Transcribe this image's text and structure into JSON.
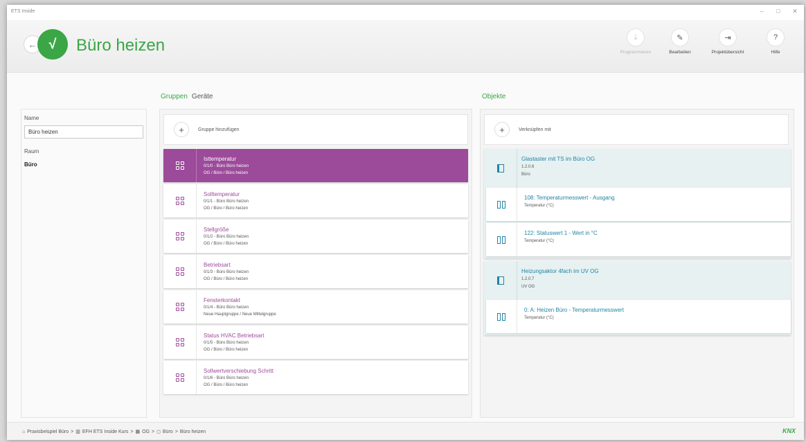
{
  "window": {
    "app_title": "ETS Inside",
    "controls": {
      "minimize": "–",
      "restore": "□",
      "close": "✕"
    }
  },
  "header": {
    "title": "Büro heizen",
    "back_icon": "←",
    "logo_glyph": "√",
    "toolbar": [
      {
        "label": "Programmieren",
        "icon": "download-icon",
        "glyph": "⤓",
        "disabled": true
      },
      {
        "label": "Bearbeiten",
        "icon": "pencil-icon",
        "glyph": "✎",
        "disabled": false
      },
      {
        "label": "Projektübersicht",
        "icon": "exit-icon",
        "glyph": "⇥",
        "disabled": false
      },
      {
        "label": "Hilfe",
        "icon": "help-icon",
        "glyph": "?",
        "disabled": false
      }
    ]
  },
  "left": {
    "name_label": "Name",
    "name_value": "Büro heizen",
    "room_label": "Raum",
    "room_value": "Büro"
  },
  "middle": {
    "tab_groups": "Gruppen",
    "tab_devices": "Geräte",
    "add_label": "Gruppe hinzufügen",
    "groups": [
      {
        "title": "Isttemperatur",
        "address": "0/1/0 - Büro Büro heizen",
        "path": "OG / Büro / Büro heizen",
        "selected": true
      },
      {
        "title": "Solltemperatur",
        "address": "0/1/1 - Büro Büro heizen",
        "path": "OG / Büro / Büro heizen",
        "selected": false
      },
      {
        "title": "Stellgröße",
        "address": "0/1/2 - Büro Büro heizen",
        "path": "OG / Büro / Büro heizen",
        "selected": false
      },
      {
        "title": "Betriebsart",
        "address": "0/1/3 - Büro Büro heizen",
        "path": "OG / Büro / Büro heizen",
        "selected": false
      },
      {
        "title": "Fensterkontakt",
        "address": "0/1/4 - Büro Büro heizen",
        "path": "Neue Hauptgruppe / Neue Mittelgruppe",
        "selected": false
      },
      {
        "title": "Status HVAC Betriebsart",
        "address": "0/1/5 - Büro Büro heizen",
        "path": "OG / Büro / Büro heizen",
        "selected": false
      },
      {
        "title": "Sollwertverschiebung Schritt",
        "address": "0/1/6 - Büro Büro heizen",
        "path": "OG / Büro / Büro heizen",
        "selected": false
      }
    ]
  },
  "right": {
    "title": "Objekte",
    "add_label": "Verknüpfen mit",
    "devices": [
      {
        "title": "Glastaster mit TS im Büro OG",
        "address": "1.2.0.6",
        "room": "Büro",
        "objects": [
          {
            "title": "108: Temperaturmesswert - Ausgang",
            "sub": "Temperatur (°C)"
          },
          {
            "title": "122: Statuswert 1 - Wert in °C",
            "sub": "Temperatur (°C)"
          }
        ]
      },
      {
        "title": "Heizungsaktor 4fach im UV OG",
        "address": "1.2.0.7",
        "room": "UV OG",
        "objects": [
          {
            "title": "0: A: Heizen Büro - Temperaturmesswert",
            "sub": "Temperatur (°C)"
          }
        ]
      }
    ]
  },
  "footer": {
    "breadcrumb": [
      {
        "icon": "home-icon",
        "glyph": "⌂",
        "label": "Praxisbeispiel Büro"
      },
      {
        "icon": "building-icon",
        "glyph": "▥",
        "label": "EFH ETS Inside Kurs"
      },
      {
        "icon": "floor-icon",
        "glyph": "▦",
        "label": "OG"
      },
      {
        "icon": "room-icon",
        "glyph": "◻",
        "label": "Büro"
      },
      {
        "icon": null,
        "glyph": "",
        "label": "Büro heizen"
      }
    ],
    "separator": ">",
    "logo": "KNX"
  },
  "colors": {
    "accent_green": "#3aa645",
    "group_purple": "#9c4a9a",
    "object_blue": "#1f84a6"
  }
}
